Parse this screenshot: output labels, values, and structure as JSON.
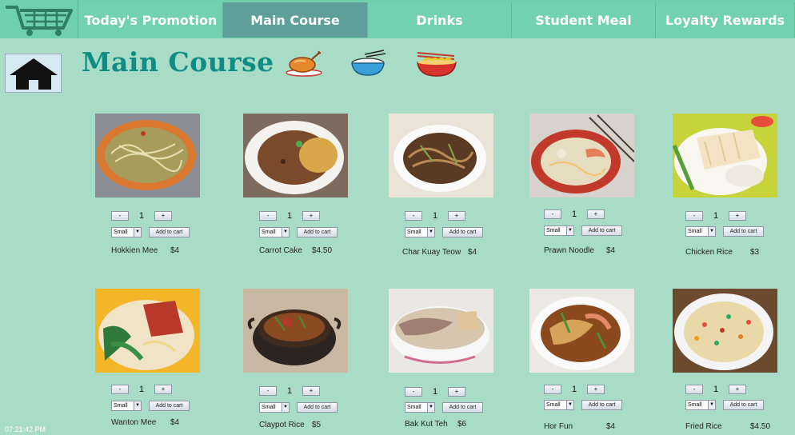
{
  "nav": {
    "tabs": [
      {
        "label": "Today's Promotion"
      },
      {
        "label": "Main Course"
      },
      {
        "label": "Drinks"
      },
      {
        "label": "Student Meal"
      },
      {
        "label": "Loyalty Rewards"
      }
    ],
    "active_tab": "Main Course"
  },
  "header": {
    "title": "Main Course"
  },
  "items": [
    {
      "name": "Hokkien Mee",
      "price": "$4",
      "qty": "1",
      "size": "Small",
      "add_label": "Add to cart"
    },
    {
      "name": "Carrot Cake",
      "price": "$4.50",
      "qty": "1",
      "size": "Small",
      "add_label": "Add to cart"
    },
    {
      "name": "Char Kuay Teow",
      "price": "$4",
      "qty": "1",
      "size": "Small",
      "add_label": "Add to cart"
    },
    {
      "name": "Prawn Noodle",
      "price": "$4",
      "qty": "1",
      "size": "Small",
      "add_label": "Add to cart"
    },
    {
      "name": "Chicken Rice",
      "price": "$3",
      "qty": "1",
      "size": "Small",
      "add_label": "Add to cart"
    },
    {
      "name": "Wanton Mee",
      "price": "$4",
      "qty": "1",
      "size": "Small",
      "add_label": "Add to cart"
    },
    {
      "name": "Claypot Rice",
      "price": "$5",
      "qty": "1",
      "size": "Small",
      "add_label": "Add to cart"
    },
    {
      "name": "Bak Kut Teh",
      "price": "$6",
      "qty": "1",
      "size": "Small",
      "add_label": "Add to cart"
    },
    {
      "name": "Hor Fun",
      "price": "$4",
      "qty": "1",
      "size": "Small",
      "add_label": "Add to cart"
    },
    {
      "name": "Fried Rice",
      "price": "$4.50",
      "qty": "1",
      "size": "Small",
      "add_label": "Add to cart"
    }
  ],
  "stepper": {
    "minus": "-",
    "plus": "+"
  },
  "status": {
    "clock": "07:21:42 PM"
  },
  "colors": {
    "background": "#a8dcc6",
    "nav": "#6fcfae",
    "nav_active": "#5f9f9a",
    "title": "#0f8c86"
  },
  "icons": [
    "cart-icon",
    "home-icon",
    "roast-chicken-icon",
    "rice-bowl-icon",
    "noodle-bowl-icon"
  ]
}
